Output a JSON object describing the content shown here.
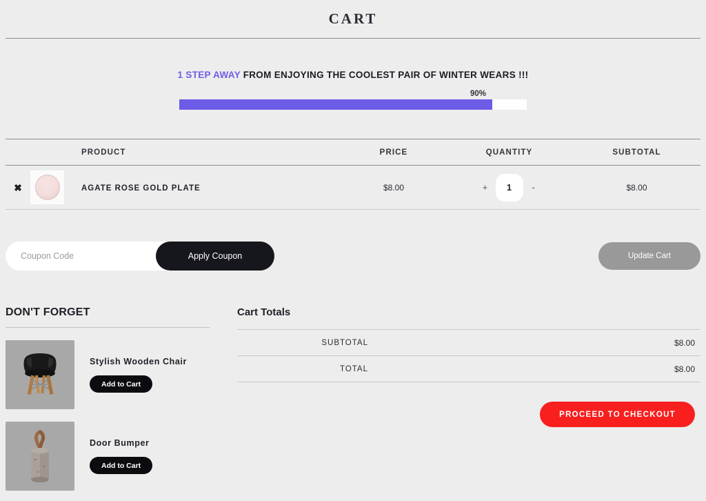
{
  "page": {
    "title": "CART"
  },
  "progress": {
    "highlight_text": "1 STEP AWAY",
    "rest_text": " FROM ENJOYING THE COOLEST PAIR OF WINTER WEARS !!!",
    "percent_label": "90%",
    "percent_value": 90,
    "fill_color": "#6c5ce7",
    "track_color": "#ffffff"
  },
  "cart_table": {
    "headers": {
      "product": "PRODUCT",
      "price": "PRICE",
      "quantity": "QUANTITY",
      "subtotal": "SUBTOTAL"
    },
    "rows": [
      {
        "remove_icon": "close-x-icon",
        "thumbnail": "agate-rose-gold-plate-thumbnail",
        "name": "AGATE ROSE GOLD PLATE",
        "price": "$8.00",
        "qty_increase": "+",
        "qty_value": "1",
        "qty_decrease": "-",
        "subtotal": "$8.00"
      }
    ]
  },
  "actions": {
    "coupon_placeholder": "Coupon Code",
    "coupon_value": "",
    "apply_label": "Apply Coupon",
    "update_label": "Update Cart",
    "update_color": "#999999"
  },
  "dont_forget": {
    "heading": "DON'T FORGET",
    "items": [
      {
        "name": "Stylish Wooden Chair",
        "button_label": "Add to Cart",
        "image": "black-eames-chair-image"
      },
      {
        "name": "Door Bumper",
        "button_label": "Add to Cart",
        "image": "concrete-door-bumper-image"
      }
    ]
  },
  "cart_totals": {
    "heading": "Cart Totals",
    "rows": [
      {
        "label": "SUBTOTAL",
        "value": "$8.00"
      },
      {
        "label": "TOTAL",
        "value": "$8.00"
      }
    ],
    "checkout_label": "PROCEED TO CHECKOUT",
    "checkout_color": "#f91f1f"
  }
}
